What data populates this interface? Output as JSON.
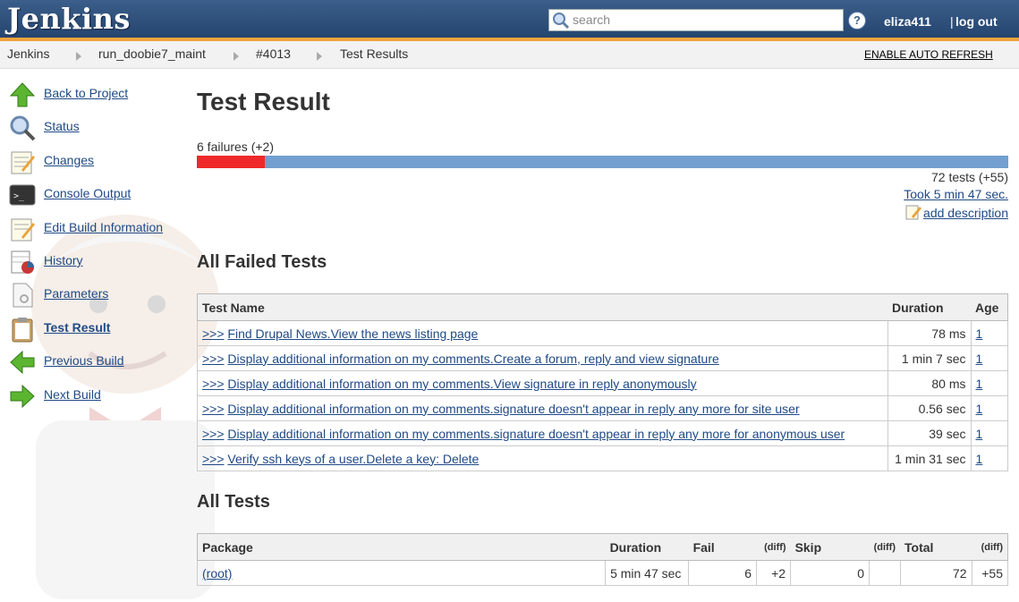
{
  "header": {
    "logo": "Jenkins",
    "search_placeholder": "search",
    "help": "?",
    "user": "eliza411",
    "separator": "|",
    "logout": "log out"
  },
  "breadcrumbs": [
    "Jenkins",
    "run_doobie7_maint",
    "#4013",
    "Test Results"
  ],
  "auto_refresh": "ENABLE AUTO REFRESH",
  "sidebar": {
    "items": [
      {
        "label": "Back to Project",
        "icon": "up-arrow-icon"
      },
      {
        "label": "Status",
        "icon": "magnifier-icon"
      },
      {
        "label": "Changes",
        "icon": "notepad-icon"
      },
      {
        "label": "Console Output",
        "icon": "terminal-icon"
      },
      {
        "label": "Edit Build Information",
        "icon": "notepad-edit-icon"
      },
      {
        "label": "History",
        "icon": "history-chart-icon"
      },
      {
        "label": "Parameters",
        "icon": "document-icon"
      },
      {
        "label": "Test Result",
        "icon": "clipboard-icon"
      },
      {
        "label": "Previous Build",
        "icon": "left-arrow-icon"
      },
      {
        "label": "Next Build",
        "icon": "right-arrow-icon"
      }
    ]
  },
  "main": {
    "title": "Test Result",
    "failures_summary": "6 failures (+2)",
    "fail_fraction": 0.0833,
    "tests_count": "72 tests (+55)",
    "took": "Took 5 min 47 sec.",
    "add_description": "add description",
    "failed_section_title": "All Failed Tests",
    "failed_headers": {
      "name": "Test Name",
      "duration": "Duration",
      "age": "Age"
    },
    "failed_tests": [
      {
        "marker": ">>>",
        "name": "Find Drupal News.View the news listing page",
        "duration": "78 ms",
        "age": "1"
      },
      {
        "marker": ">>>",
        "name": "Display additional information on my comments.Create a forum, reply and view signature",
        "duration": "1 min 7 sec",
        "age": "1"
      },
      {
        "marker": ">>>",
        "name": "Display additional information on my comments.View signature in reply anonymously",
        "duration": "80 ms",
        "age": "1"
      },
      {
        "marker": ">>>",
        "name": "Display additional information on my comments.signature doesn't appear in reply any more for site user",
        "duration": "0.56 sec",
        "age": "1"
      },
      {
        "marker": ">>>",
        "name": "Display additional information on my comments.signature doesn't appear in reply any more for anonymous user",
        "duration": "39 sec",
        "age": "1"
      },
      {
        "marker": ">>>",
        "name": "Verify ssh keys of a user.Delete a key: Delete",
        "duration": "1 min 31 sec",
        "age": "1"
      }
    ],
    "all_section_title": "All Tests",
    "all_headers": {
      "package": "Package",
      "duration": "Duration",
      "fail": "Fail",
      "diff": "(diff)",
      "skip": "Skip",
      "total": "Total"
    },
    "all_tests": [
      {
        "package": "(root)",
        "duration": "5 min 47 sec",
        "fail": "6",
        "fail_diff": "+2",
        "skip": "0",
        "skip_diff": "",
        "total": "72",
        "total_diff": "+55"
      }
    ]
  },
  "colors": {
    "header": "#3b5e8a",
    "accent": "#f0a23c",
    "fail": "#ef2929",
    "pass": "#729fcf",
    "link": "#204a87"
  }
}
